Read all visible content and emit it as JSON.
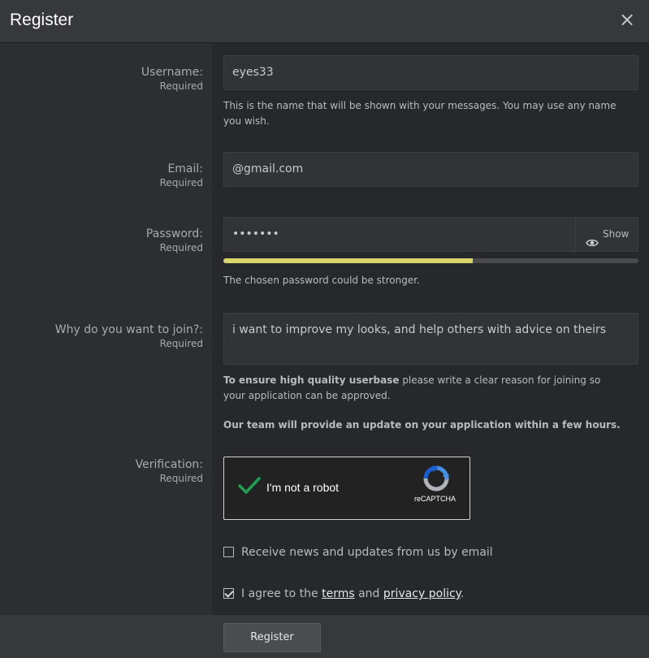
{
  "dialog": {
    "title": "Register",
    "close_glyph": "×"
  },
  "fields": {
    "username": {
      "label": "Username:",
      "required": "Required",
      "value": "eyes33",
      "hint": "This is the name that will be shown with your messages. You may use any name you wish."
    },
    "email": {
      "label": "Email:",
      "required": "Required",
      "value": "@gmail.com"
    },
    "password": {
      "label": "Password:",
      "required": "Required",
      "value": "•••••••",
      "show_label": "Show",
      "strength": 0.6,
      "strength_color": "#d9d66a",
      "hint": "The chosen password could be stronger."
    },
    "reason": {
      "label": "Why do you want to join?:",
      "required": "Required",
      "value": "i want to improve my looks, and help others with advice on theirs",
      "note_bold": "To ensure high quality userbase",
      "note_rest": " please write a clear reason for joining so your application can be approved.",
      "note_update": "Our team will provide an update on your application within a few hours."
    },
    "verification": {
      "label": "Verification:",
      "required": "Required",
      "captcha_text": "I'm not a robot",
      "captcha_brand": "reCAPTCHA",
      "checked": true
    }
  },
  "options": {
    "newsletter": {
      "label": "Receive news and updates from us by email",
      "checked": false
    },
    "agree": {
      "prefix": "I agree to the ",
      "terms": "terms",
      "middle": " and ",
      "privacy": "privacy policy",
      "suffix": ".",
      "checked": true
    }
  },
  "footer": {
    "register_label": "Register"
  },
  "colors": {
    "accent_check": "#1fa151",
    "header_bg": "#37383c",
    "panel_bg": "#27282c"
  }
}
